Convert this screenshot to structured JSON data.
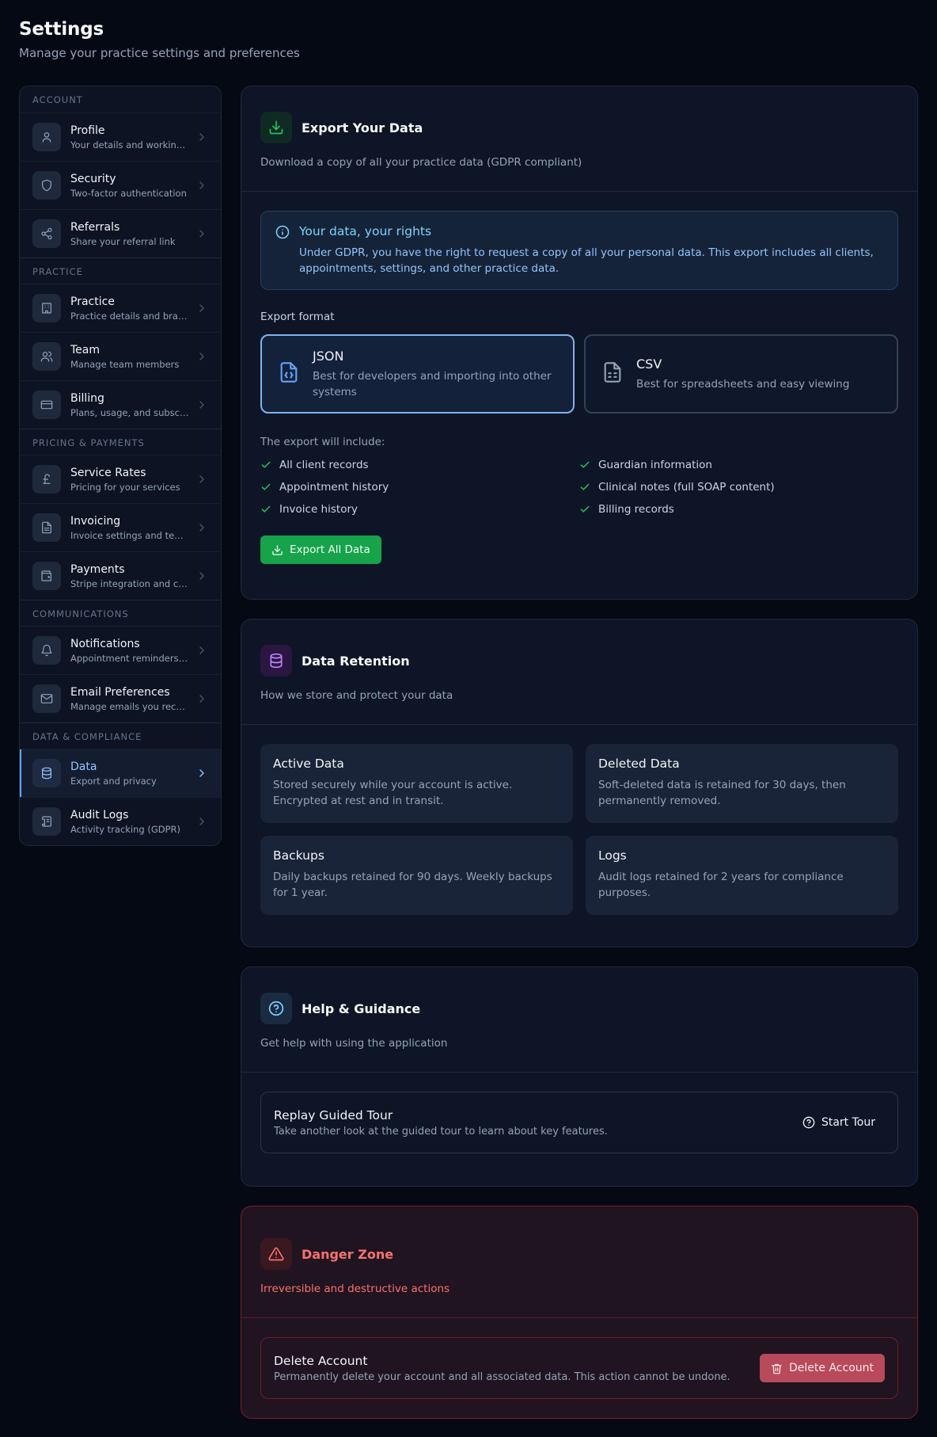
{
  "header": {
    "title": "Settings",
    "subtitle": "Manage your practice settings and preferences"
  },
  "sidebar": {
    "sections": [
      {
        "label": "ACCOUNT",
        "items": [
          {
            "title": "Profile",
            "subtitle": "Your details and working ...",
            "icon": "user-icon"
          },
          {
            "title": "Security",
            "subtitle": "Two-factor authentication",
            "icon": "shield-icon"
          },
          {
            "title": "Referrals",
            "subtitle": "Share your referral link",
            "icon": "share-icon"
          }
        ]
      },
      {
        "label": "PRACTICE",
        "items": [
          {
            "title": "Practice",
            "subtitle": "Practice details and bran...",
            "icon": "building-icon"
          },
          {
            "title": "Team",
            "subtitle": "Manage team members",
            "icon": "users-icon"
          },
          {
            "title": "Billing",
            "subtitle": "Plans, usage, and subscri...",
            "icon": "credit-card-icon"
          }
        ]
      },
      {
        "label": "PRICING & PAYMENTS",
        "items": [
          {
            "title": "Service Rates",
            "subtitle": "Pricing for your services",
            "icon": "pound-icon"
          },
          {
            "title": "Invoicing",
            "subtitle": "Invoice settings and temp...",
            "icon": "file-text-icon"
          },
          {
            "title": "Payments",
            "subtitle": "Stripe integration and car...",
            "icon": "wallet-icon"
          }
        ]
      },
      {
        "label": "COMMUNICATIONS",
        "items": [
          {
            "title": "Notifications",
            "subtitle": "Appointment reminders a...",
            "icon": "bell-icon"
          },
          {
            "title": "Email Preferences",
            "subtitle": "Manage emails you receive",
            "icon": "mail-icon"
          }
        ]
      },
      {
        "label": "DATA & COMPLIANCE",
        "items": [
          {
            "title": "Data",
            "subtitle": "Export and privacy",
            "icon": "database-icon",
            "active": true
          },
          {
            "title": "Audit Logs",
            "subtitle": "Activity tracking (GDPR)",
            "icon": "scroll-icon"
          }
        ]
      }
    ]
  },
  "export": {
    "title": "Export Your Data",
    "description": "Download a copy of all your practice data (GDPR compliant)",
    "info_title": "Your data, your rights",
    "info_text": "Under GDPR, you have the right to request a copy of all your personal data. This export includes all clients, appointments, settings, and other practice data.",
    "format_label": "Export format",
    "formats": [
      {
        "title": "JSON",
        "description": "Best for developers and importing into other systems",
        "selected": true
      },
      {
        "title": "CSV",
        "description": "Best for spreadsheets and easy viewing",
        "selected": false
      }
    ],
    "include_label": "The export will include:",
    "include_items": [
      "All client records",
      "Guardian information",
      "Appointment history",
      "Clinical notes (full SOAP content)",
      "Invoice history",
      "Billing records"
    ],
    "button_label": "Export All Data"
  },
  "retention": {
    "title": "Data Retention",
    "description": "How we store and protect your data",
    "items": [
      {
        "title": "Active Data",
        "text": "Stored securely while your account is active. Encrypted at rest and in transit."
      },
      {
        "title": "Deleted Data",
        "text": "Soft-deleted data is retained for 30 days, then permanently removed."
      },
      {
        "title": "Backups",
        "text": "Daily backups retained for 90 days. Weekly backups for 1 year."
      },
      {
        "title": "Logs",
        "text": "Audit logs retained for 2 years for compliance purposes."
      }
    ]
  },
  "help": {
    "title": "Help & Guidance",
    "description": "Get help with using the application",
    "row_title": "Replay Guided Tour",
    "row_desc": "Take another look at the guided tour to learn about key features.",
    "button_label": "Start Tour"
  },
  "danger": {
    "title": "Danger Zone",
    "description": "Irreversible and destructive actions",
    "row_title": "Delete Account",
    "row_desc": "Permanently delete your account and all associated data. This action cannot be undone.",
    "button_label": "Delete Account"
  },
  "colors": {
    "background": "#050914",
    "accent_blue": "#60a5fa",
    "success_green": "#16a34a",
    "danger_red": "#f87171"
  }
}
